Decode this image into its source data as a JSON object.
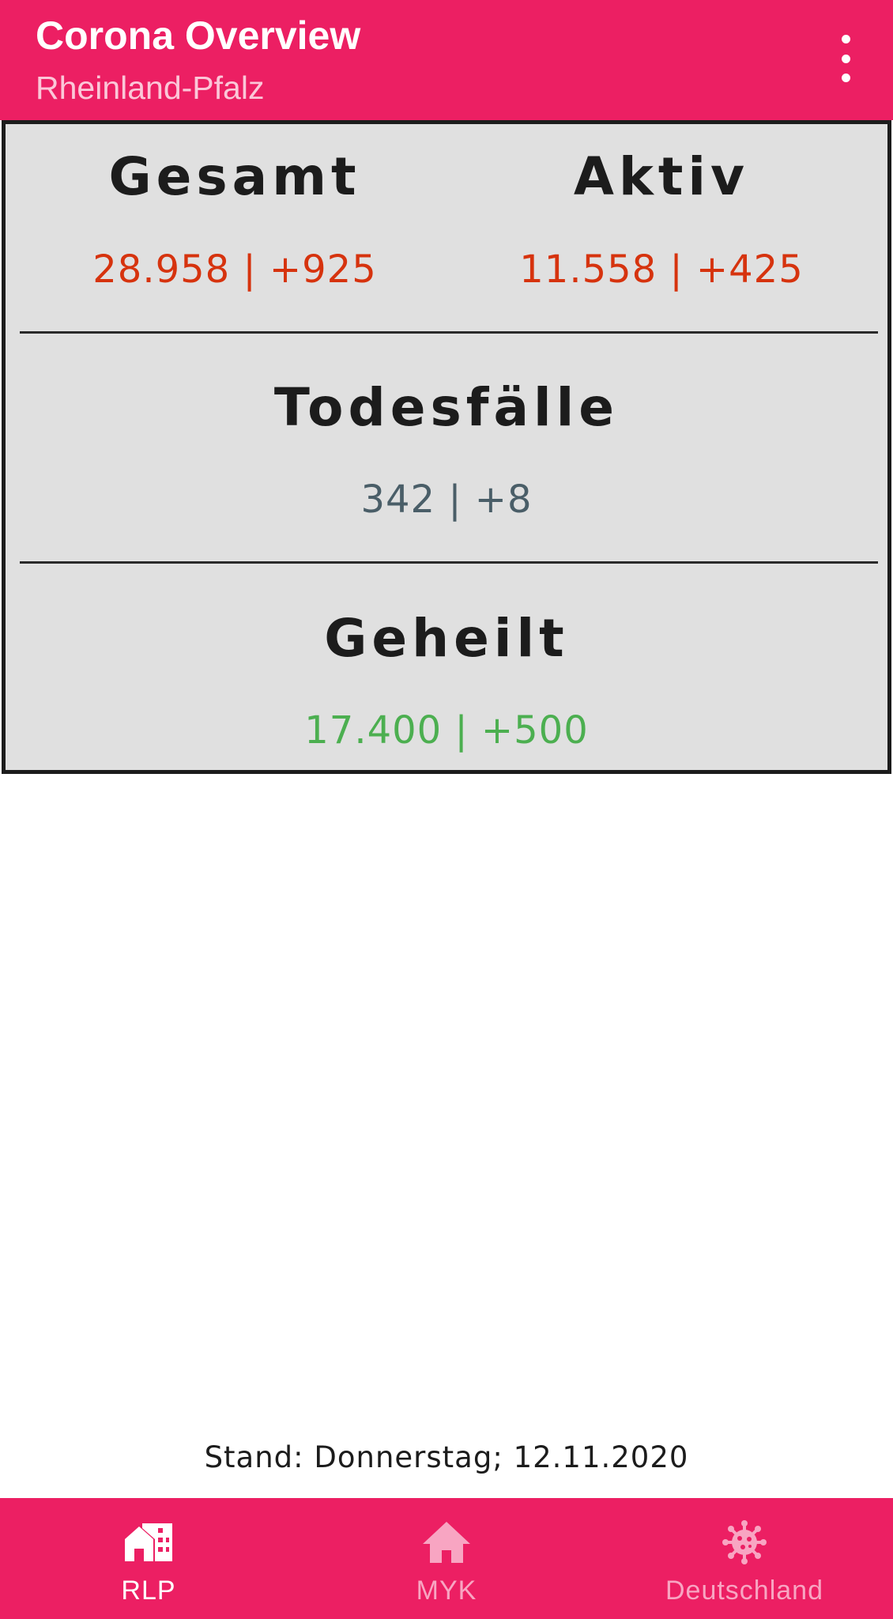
{
  "app_bar": {
    "title": "Corona Overview",
    "subtitle": "Rheinland-Pfalz",
    "menu_icon": "more-vert-icon"
  },
  "stats": {
    "gesamt": {
      "label": "Gesamt",
      "value": "28.958 | +925",
      "color": "#D6330E"
    },
    "aktiv": {
      "label": "Aktiv",
      "value": "11.558 | +425",
      "color": "#D6330E"
    },
    "todesfaelle": {
      "label": "Todesfälle",
      "value": "342 | +8",
      "color": "#4A5E68"
    },
    "geheilt": {
      "label": "Geheilt",
      "value": "17.400 | +500",
      "color": "#4CAF50"
    }
  },
  "footer": {
    "stand": "Stand: Donnerstag; 12.11.2020"
  },
  "bottom_nav": {
    "items": [
      {
        "label": "RLP",
        "icon": "city-home-icon",
        "active": true
      },
      {
        "label": "MYK",
        "icon": "home-icon",
        "active": false
      },
      {
        "label": "Deutschland",
        "icon": "virus-icon",
        "active": false
      }
    ],
    "active_color": "#FFFFFF",
    "inactive_color": "#F8A5C2"
  },
  "colors": {
    "primary": "#EC1F63",
    "card_background": "#E0E0E0"
  }
}
